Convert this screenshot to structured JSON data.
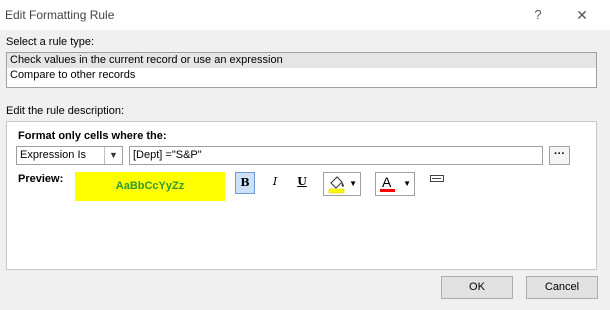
{
  "window": {
    "title": "Edit Formatting Rule",
    "help": "?",
    "close": "✕"
  },
  "rule_type": {
    "label": "Select a rule type:",
    "items": [
      "Check values in the current record or use an expression",
      "Compare to other records"
    ]
  },
  "description": {
    "label": "Edit the rule description:",
    "heading": "Format only cells where the:",
    "condition": "Expression Is",
    "expression": "[Dept] =\"S&P\"",
    "builder": "···"
  },
  "preview": {
    "label": "Preview:",
    "sample": "AaBbCcYyZz",
    "background": "#ffff00",
    "text_color": "#2e9a2e"
  },
  "format_buttons": {
    "bold": "B",
    "italic": "I",
    "underline": "U",
    "font_color_letter": "A",
    "fill_color": "#ffff00",
    "font_color": "#ff0000"
  },
  "buttons": {
    "ok": "OK",
    "cancel": "Cancel"
  }
}
